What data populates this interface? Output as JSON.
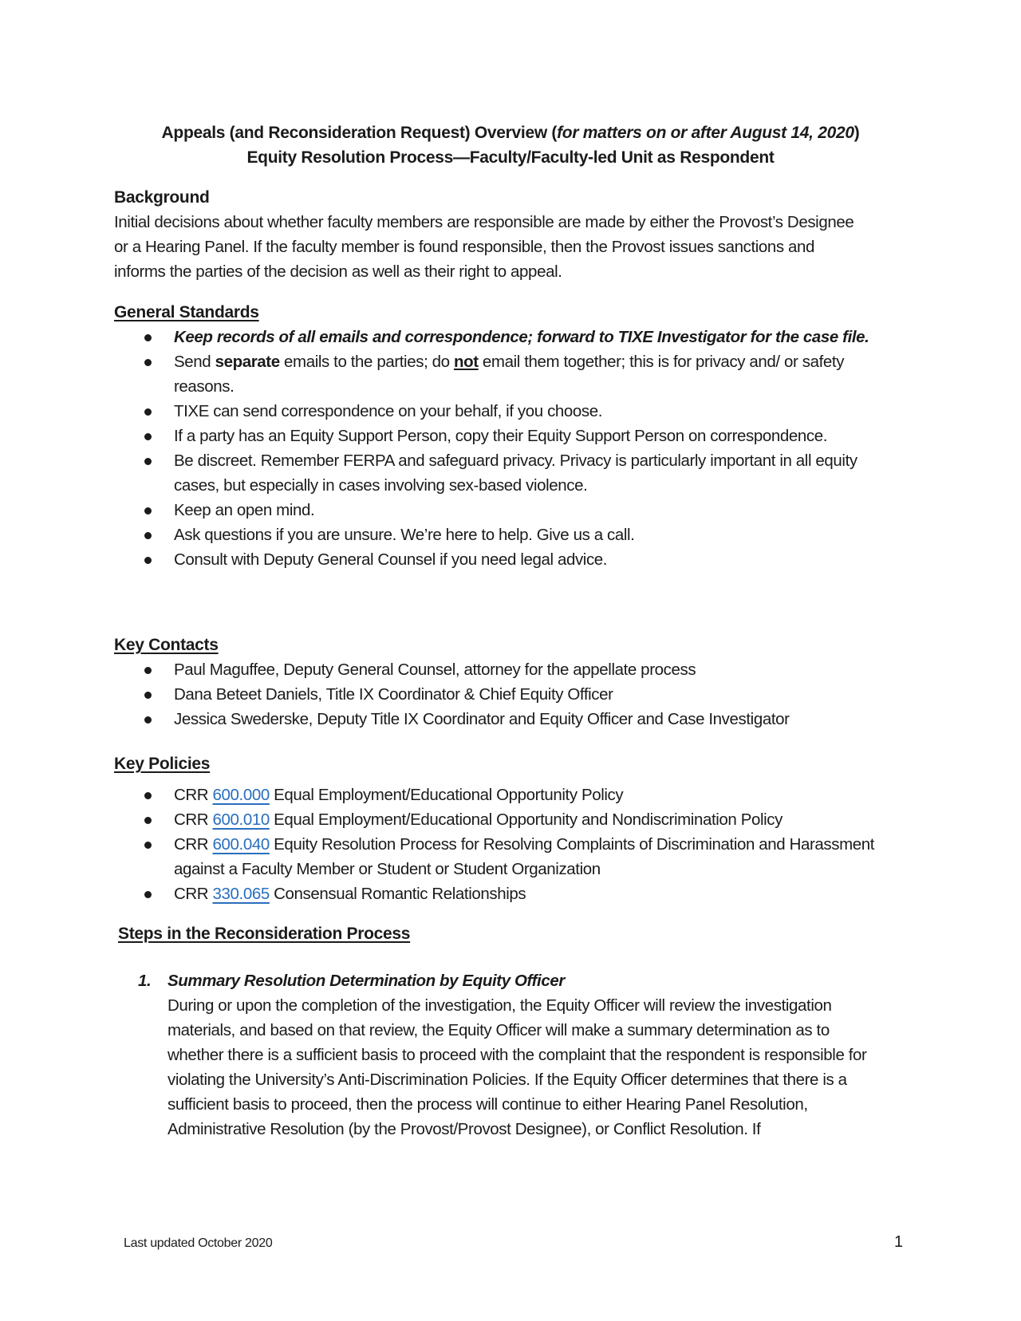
{
  "title": {
    "line1_prefix": "Appeals (and Reconsideration Request) Overview (",
    "line1_italic": "for matters on or after August 14, 2020",
    "line1_suffix": ")",
    "line2": "Equity Resolution Process—Faculty/Faculty-led Unit as Respondent"
  },
  "background": {
    "heading": "Background",
    "text": "Initial decisions about whether faculty members are responsible are made by either the Provost’s Designee or a Hearing Panel. If the faculty member is found responsible, then the Provost issues sanctions and informs the parties of the decision as well as their right to appeal."
  },
  "general_standards": {
    "heading": "General Standards",
    "item1": "Keep records of all emails and correspondence; forward to TIXE Investigator for the case file.",
    "item2": {
      "part1": "Send ",
      "bold": "separate",
      "part2": " emails to the parties; do ",
      "bold_underline": "not",
      "part3": " email them together; this is for privacy and/ or safety reasons."
    },
    "items": [
      "TIXE can send correspondence on your behalf, if you choose.",
      "If a party has an Equity Support Person, copy their Equity Support Person on correspondence.",
      "Be discreet. Remember FERPA and safeguard privacy. Privacy is particularly important in all equity cases, but especially in cases involving sex-based violence.",
      "Keep an open mind.",
      "Ask questions if you are unsure. We’re here to help. Give us a call.",
      "Consult with Deputy General Counsel if you need legal advice."
    ]
  },
  "key_contacts": {
    "heading": "Key Contacts",
    "items": [
      "Paul Maguffee, Deputy General Counsel, attorney for the appellate process",
      "Dana Beteet Daniels, Title IX Coordinator & Chief Equity Officer",
      "Jessica Swederske, Deputy Title IX Coordinator and Equity Officer and Case Investigator"
    ]
  },
  "key_policies": {
    "heading": "Key Policies",
    "prefix": "CRR ",
    "items": [
      {
        "number": "600.000",
        "title": " Equal Employment/Educational Opportunity Policy"
      },
      {
        "number": "600.010",
        "title": " Equal Employment/Educational Opportunity and Nondiscrimination Policy"
      },
      {
        "number": "600.040",
        "title": " Equity Resolution Process for Resolving Complaints of Discrimination and Harassment against a Faculty Member or Student or Student Organization"
      },
      {
        "number": "330.065",
        "title": " Consensual Romantic Relationships"
      }
    ],
    "link_color": "#2a6fbd"
  },
  "steps": {
    "heading": "Steps in the Reconsideration Process",
    "items": [
      {
        "number": "1.",
        "title": "Summary Resolution Determination by Equity Officer",
        "text": "During or upon the completion of the investigation, the Equity Officer will review the investigation materials, and based on that review, the Equity Officer will make a summary determination as to whether there is a sufficient basis to proceed with the complaint that the respondent is responsible for violating the University’s Anti-Discrimination Policies. If the Equity Officer determines that there is a sufficient basis to proceed, then the process will continue to either Hearing Panel Resolution, Administrative Resolution (by the Provost/Provost Designee), or Conflict Resolution. If"
      }
    ]
  },
  "footer": {
    "last_updated": "Last updated October 2020",
    "page_number": "1"
  }
}
